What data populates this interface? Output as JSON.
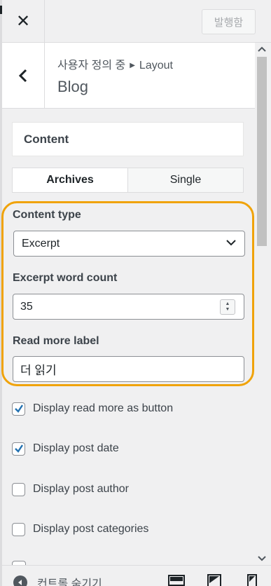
{
  "header": {
    "close_icon": "close-icon",
    "publish_label": "발행함"
  },
  "section": {
    "breadcrumb_parent": "사용자 정의 중",
    "breadcrumb_child": "Layout",
    "title": "Blog"
  },
  "content_heading": "Content",
  "tabs": [
    {
      "label": "Archives",
      "active": true
    },
    {
      "label": "Single",
      "active": false
    }
  ],
  "fields": {
    "content_type": {
      "label": "Content type",
      "value": "Excerpt"
    },
    "excerpt_word_count": {
      "label": "Excerpt word count",
      "value": "35"
    },
    "read_more_label": {
      "label": "Read more label",
      "value": "더 읽기"
    }
  },
  "checkboxes": [
    {
      "label": "Display read more as button",
      "checked": true
    },
    {
      "label": "Display post date",
      "checked": true
    },
    {
      "label": "Display post author",
      "checked": false
    },
    {
      "label": "Display post categories",
      "checked": false
    }
  ],
  "footer": {
    "collapse_label": "컨트롤 숨기기"
  },
  "colors": {
    "highlight": "#f0a30a",
    "checkbox_checked": "#2271b1"
  }
}
